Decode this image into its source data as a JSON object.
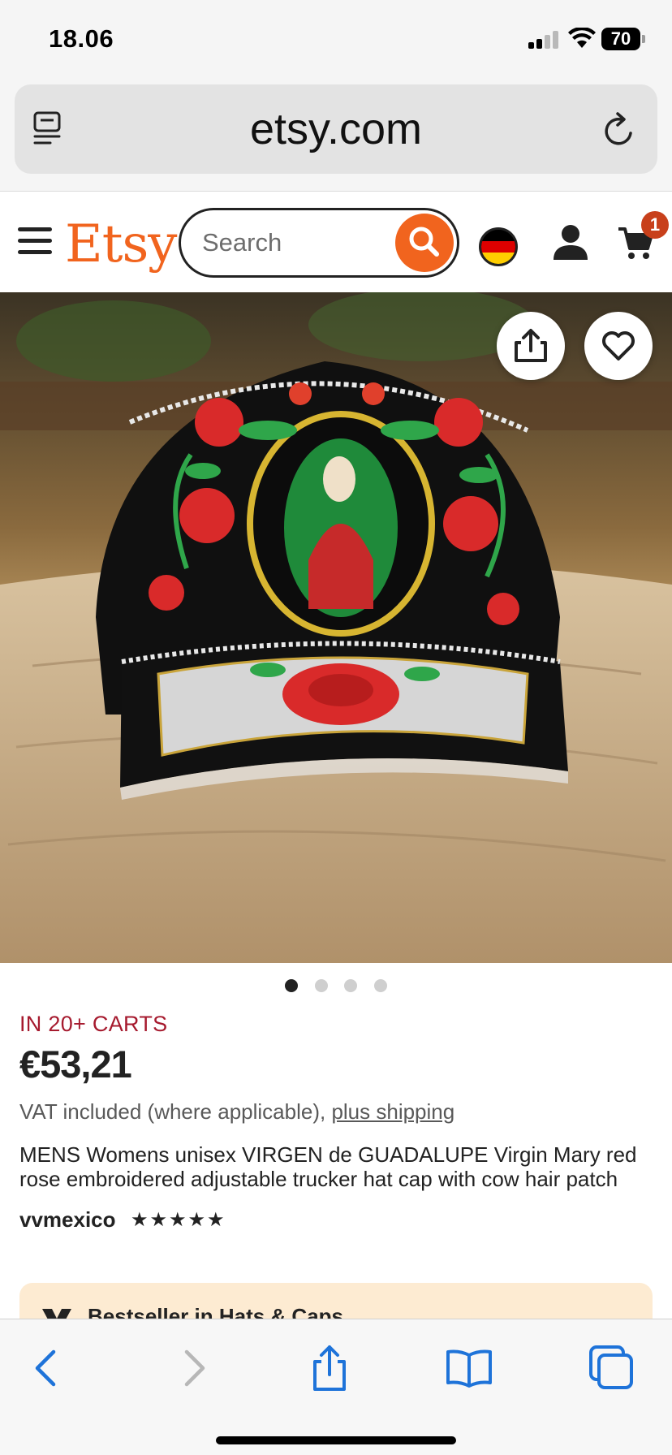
{
  "status_bar": {
    "time": "18.06",
    "battery": "70"
  },
  "browser": {
    "url": "etsy.com"
  },
  "header": {
    "logo": "Etsy",
    "search_placeholder": "Search",
    "cart_count": "1",
    "flag_colors": [
      "#000000",
      "#DD0000",
      "#FFCE00"
    ]
  },
  "gallery": {
    "image_count": 4,
    "active_index": 0
  },
  "product": {
    "carts_badge": "IN 20+ CARTS",
    "price": "€53,21",
    "vat_text": "VAT included (where applicable),",
    "shipping_link": "plus shipping",
    "title": "MENS Womens unisex VIRGEN de GUADALUPE Virgin Mary red rose embroidered adjustable trucker hat cap with cow hair patch",
    "seller": "vvmexico",
    "rating": "★★★★★",
    "bestseller": "Bestseller in Hats & Caps"
  },
  "colors": {
    "brand": "#F1641E",
    "accent_red": "#A61A2E",
    "ios_blue": "#1E73D9"
  },
  "icons": {
    "reader": "reader-icon",
    "reload": "reload-icon",
    "share": "share-icon",
    "favorite": "heart-icon",
    "back": "back-arrow-icon",
    "forward": "forward-arrow-icon",
    "bookmarks": "book-icon",
    "tabs": "tabs-icon"
  }
}
